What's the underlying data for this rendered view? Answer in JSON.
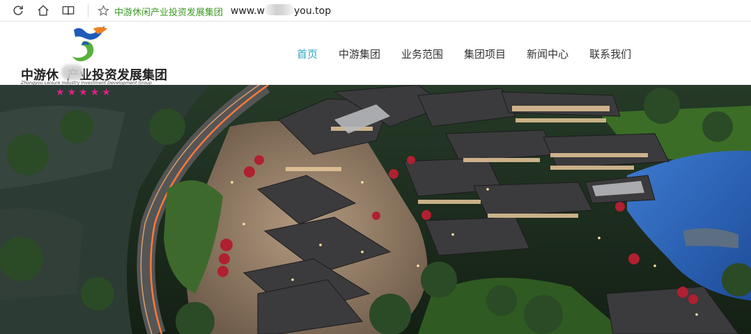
{
  "browser": {
    "page_title": "中游休闲产业投资发展集团",
    "url_prefix": "www.w",
    "url_suffix": "you.top",
    "icons": [
      "refresh-icon",
      "home-icon",
      "reader-icon",
      "favorite-star-icon"
    ]
  },
  "site": {
    "logo_cn_before": "中游休",
    "logo_cn_after": "产业投资发展集团",
    "logo_en": "Zhongyou Leisure Industry Investment Development Group",
    "logo_stars": [
      "★",
      "★",
      "★",
      "★",
      "★"
    ],
    "nav": [
      {
        "label": "首页"
      },
      {
        "label": "中游集团"
      },
      {
        "label": "业务范围"
      },
      {
        "label": "集团项目"
      },
      {
        "label": "新闻中心"
      },
      {
        "label": "联系我们"
      }
    ],
    "colors": {
      "accent": "#2aa6c9",
      "title_green": "#3a9a23",
      "logo_blue": "#1e5bb8",
      "logo_orange": "#f0801f",
      "logo_green": "#56b23c",
      "star_pink": "#e0218a"
    }
  }
}
